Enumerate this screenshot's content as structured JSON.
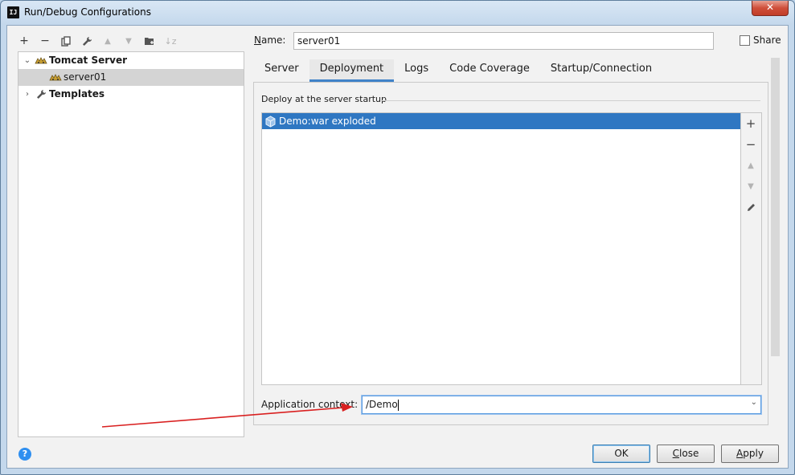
{
  "window": {
    "title": "Run/Debug Configurations",
    "app_icon_text": "IJ"
  },
  "toolbar": {
    "buttons": [
      {
        "name": "add-button",
        "glyph": "+"
      },
      {
        "name": "remove-button",
        "glyph": "−"
      },
      {
        "name": "copy-button",
        "glyph": "⧉"
      },
      {
        "name": "edit-defaults-button",
        "glyph": "🔧"
      },
      {
        "name": "move-up-button",
        "glyph": "▲"
      },
      {
        "name": "move-down-button",
        "glyph": "▼"
      },
      {
        "name": "new-folder-button",
        "glyph": "📁"
      },
      {
        "name": "sort-button",
        "glyph": "↓z"
      }
    ]
  },
  "tree": {
    "group": "Tomcat Server",
    "item": "server01",
    "templates": "Templates"
  },
  "form": {
    "name_label": "Name:",
    "name_value": "server01",
    "share_label": "Share"
  },
  "tabs": [
    "Server",
    "Deployment",
    "Logs",
    "Code Coverage",
    "Startup/Connection"
  ],
  "active_tab": "Deployment",
  "deployment": {
    "group_title": "Deploy at the server startup",
    "artifacts": [
      "Demo:war exploded"
    ],
    "app_context_label": "Application context:",
    "app_context_value": "/Demo"
  },
  "buttons": {
    "ok": "OK",
    "close": "Close",
    "apply": "Apply"
  },
  "colors": {
    "selection": "#2f77c2",
    "tab_underline": "#4083c9",
    "arrow": "#d92020"
  }
}
